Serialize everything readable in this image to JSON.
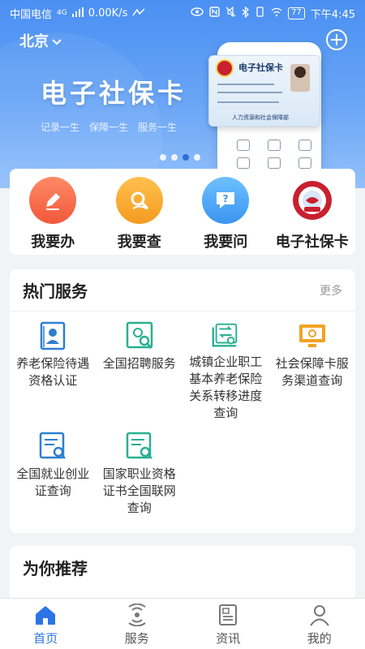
{
  "status_bar": {
    "carrier": "中国电信",
    "network": "4G",
    "speed": "0.00K/s",
    "battery": "77",
    "time": "下午4:45"
  },
  "header": {
    "city": "北京",
    "city_icon": "chevron-down-icon",
    "add_icon": "plus-circle-icon"
  },
  "banner": {
    "title": "电子社保卡",
    "tags": [
      "记录一生",
      "保障一生",
      "服务一生"
    ],
    "card_title": "电子社保卡",
    "card_footer": "人力资源和社会保障部",
    "slide_count": 4,
    "active_slide": 3
  },
  "quick_actions": [
    {
      "label": "我要办",
      "icon": "pen-icon",
      "color": "#f46a4a"
    },
    {
      "label": "我要查",
      "icon": "magnifier-icon",
      "color": "#f6a223"
    },
    {
      "label": "我要问",
      "icon": "question-bubble-icon",
      "color": "#3fa0f2"
    },
    {
      "label": "电子社保卡",
      "icon": "social-security-card-icon",
      "color": "#c8202f"
    }
  ],
  "hot_services": {
    "title": "热门服务",
    "more": "更多",
    "items": [
      {
        "label": "养老保险待遇资格认证",
        "icon": "pension-certification-icon",
        "color": "#2e7fd0"
      },
      {
        "label": "全国招聘服务",
        "icon": "recruitment-search-icon",
        "color": "#27b091"
      },
      {
        "label": "城镇企业职工基本养老保险关系转移进度查询",
        "icon": "pension-transfer-icon",
        "color": "#27b091"
      },
      {
        "label": "社会保障卡服务渠道查询",
        "icon": "card-channel-monitor-icon",
        "color": "#f1a224"
      },
      {
        "label": "全国就业创业证查询",
        "icon": "employment-certificate-icon",
        "color": "#2e7fd0"
      },
      {
        "label": "国家职业资格证书全国联网查询",
        "icon": "qualification-certificate-icon",
        "color": "#27b091"
      }
    ]
  },
  "recommend": {
    "title": "为你推荐"
  },
  "nav": {
    "items": [
      {
        "label": "首页",
        "icon": "home-icon",
        "active": true
      },
      {
        "label": "服务",
        "icon": "service-signal-icon",
        "active": false
      },
      {
        "label": "资讯",
        "icon": "news-icon",
        "active": false
      },
      {
        "label": "我的",
        "icon": "profile-icon",
        "active": false
      }
    ],
    "active_color": "#2d74e6"
  }
}
